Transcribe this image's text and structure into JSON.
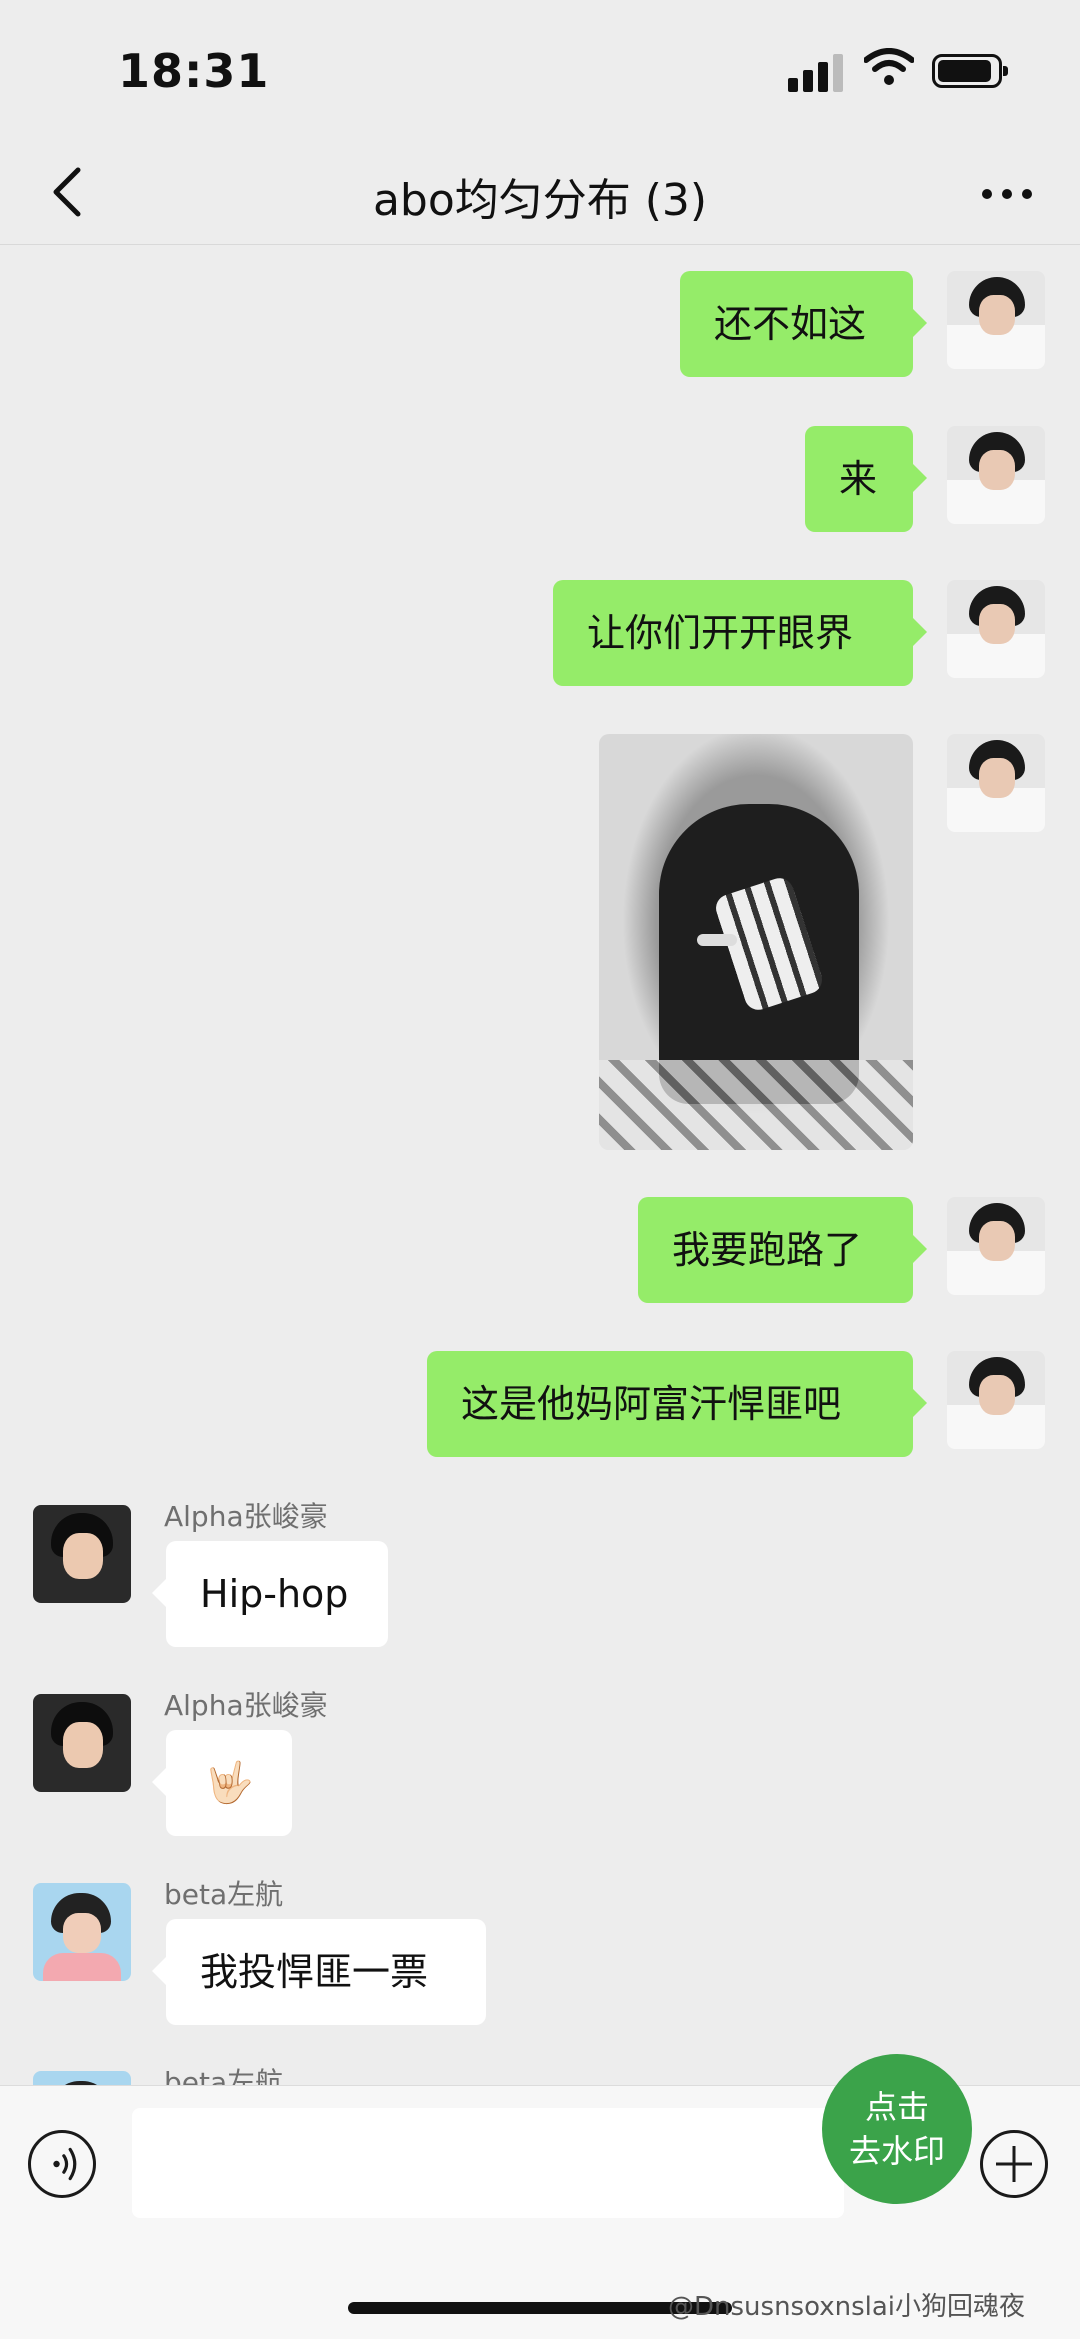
{
  "status_bar": {
    "time": "18:31"
  },
  "nav": {
    "title": "abo均匀分布 (3)"
  },
  "messages": [
    {
      "text": "还不如这"
    },
    {
      "text": "来"
    },
    {
      "text": "让你们开开眼界"
    },
    {
      "text": "我要跑路了"
    },
    {
      "text": "这是他妈阿富汗悍匪吧"
    },
    {
      "sender": "Alpha张峻豪",
      "text": "Hip-hop"
    },
    {
      "sender": "Alpha张峻豪",
      "text": "🤟🏻"
    },
    {
      "sender": "beta左航",
      "text": "我投悍匪一票"
    },
    {
      "sender": "beta左航"
    }
  ],
  "watermark_button": {
    "line1": "点击",
    "line2": "去水印"
  },
  "footer": {
    "weibo_handle": "@Dnsusnsoxnslai小狗回魂夜"
  }
}
